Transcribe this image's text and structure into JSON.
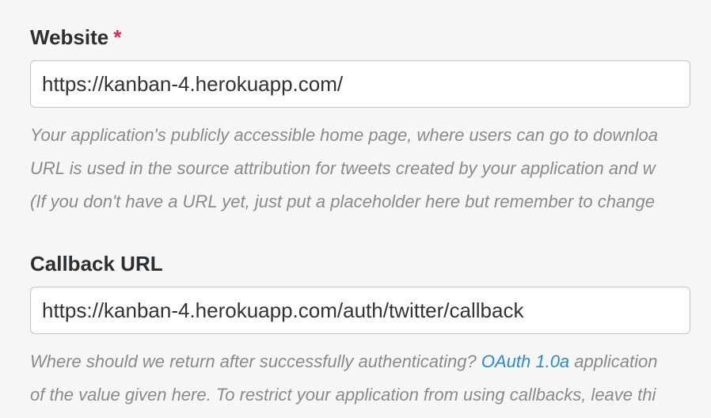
{
  "website": {
    "label": "Website",
    "required_mark": "*",
    "value": "https://kanban-4.herokuapp.com/",
    "help_lines": [
      "Your application's publicly accessible home page, where users can go to downloa",
      "URL is used in the source attribution for tweets created by your application and w",
      "(If you don't have a URL yet, just put a placeholder here but remember to change"
    ]
  },
  "callback": {
    "label": "Callback URL",
    "value": "https://kanban-4.herokuapp.com/auth/twitter/callback",
    "help_line1_before": "Where should we return after successfully authenticating? ",
    "help_link": "OAuth 1.0a",
    "help_line1_after": " application",
    "help_line2": "of the value given here. To restrict your application from using callbacks, leave thi"
  },
  "colors": {
    "background": "#f6f6f6",
    "required": "#e0245e",
    "link": "#2a8bcf",
    "help_text": "#8a8a8a"
  }
}
